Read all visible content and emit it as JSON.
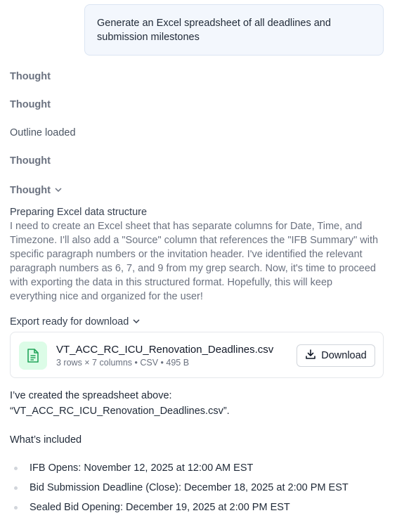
{
  "user_message": "Generate an Excel spreadsheet of all deadlines and submission milestones",
  "steps": {
    "thought_1": "Thought",
    "thought_2": "Thought",
    "outline": "Outline loaded",
    "thought_3": "Thought",
    "thought_4": "Thought"
  },
  "reasoning": {
    "title": "Preparing Excel data structure",
    "body": "I need to create an Excel sheet that has separate columns for Date, Time, and Timezone. I'll also add a \"Source\" column that references the \"IFB Summary\" with specific paragraph numbers or the invitation header. I've identified the relevant paragraph numbers as 6, 7, and 9 from my grep search. Now, it's time to proceed with exporting the data in this structured format. Hopefully, this will keep everything nice and organized for the user!"
  },
  "export": {
    "label": "Export ready for download",
    "file_name": "VT_ACC_RC_ICU_Renovation_Deadlines.csv",
    "file_meta": "3 rows × 7 columns • CSV • 495 B",
    "download_label": "Download"
  },
  "response": {
    "intro_line1": "I’ve created the spreadsheet above:",
    "intro_line2": "“VT_ACC_RC_ICU_Renovation_Deadlines.csv”.",
    "section_title": "What’s included",
    "items": [
      "IFB Opens: November 12, 2025 at 12:00 AM EST",
      "Bid Submission Deadline (Close): December 18, 2025 at 2:00 PM EST",
      "Sealed Bid Opening: December 19, 2025 at 2:00 PM EST"
    ]
  },
  "colors": {
    "user_bubble_bg": "#f3f7fd",
    "file_icon_bg": "#dcfce7",
    "file_icon_fg": "#22a45a"
  }
}
